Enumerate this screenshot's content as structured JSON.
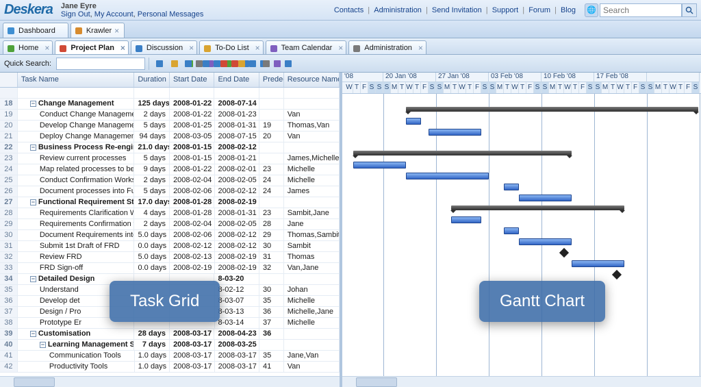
{
  "app": {
    "logo": "Deskera",
    "user": "Jane Eyre",
    "user_links": [
      "Sign Out",
      "My Account",
      "Personal Messages"
    ],
    "header_links": [
      "Contacts",
      "Administration",
      "Send Invitation",
      "Support",
      "Forum",
      "Blog"
    ],
    "search_placeholder": "Search"
  },
  "toptabs": [
    {
      "label": "Dashboard"
    },
    {
      "label": "Krawler",
      "active": true
    }
  ],
  "subtabs": [
    {
      "label": "Home"
    },
    {
      "label": "Project Plan",
      "active": true
    },
    {
      "label": "Discussion"
    },
    {
      "label": "To-Do List"
    },
    {
      "label": "Team Calendar"
    },
    {
      "label": "Administration"
    }
  ],
  "quick_search_label": "Quick Search:",
  "toolbar_icons": [
    "new",
    "open",
    "save",
    "cut",
    "copy",
    "print",
    "export",
    "import",
    "indent",
    "outdent",
    "undo",
    "redo",
    "up",
    "down",
    "add-user",
    "remove-user",
    "link",
    "zoom-in",
    "zoom-out",
    "filter",
    "columns",
    "settings",
    "help"
  ],
  "grid": {
    "cols": [
      "",
      "Task Name",
      "Duration",
      "Start Date",
      "End Date",
      "Predec",
      "Resource Names"
    ],
    "rows": [
      {
        "n": "",
        "task": "",
        "dur": "",
        "sd": "",
        "ed": "",
        "pred": "",
        "res": ""
      },
      {
        "n": "18",
        "task": "Change Management",
        "dur": "125 days",
        "sd": "2008-01-22",
        "ed": "2008-07-14",
        "pred": "",
        "res": "",
        "parent": true,
        "indent": 1
      },
      {
        "n": "19",
        "task": "Conduct Change Management Pl",
        "dur": "2 days",
        "sd": "2008-01-22",
        "ed": "2008-01-23",
        "pred": "",
        "res": "Van",
        "indent": 2
      },
      {
        "n": "20",
        "task": "Develop Change Management Pl",
        "dur": "5 days",
        "sd": "2008-01-25",
        "ed": "2008-01-31",
        "pred": "19",
        "res": "Thomas,Van",
        "indent": 2
      },
      {
        "n": "21",
        "task": "Deploy Change Management Act",
        "dur": "94 days",
        "sd": "2008-03-05",
        "ed": "2008-07-15",
        "pred": "20",
        "res": "Van",
        "indent": 2
      },
      {
        "n": "22",
        "task": "Business Process Re-engineerin",
        "dur": "21.0 days",
        "sd": "2008-01-15",
        "ed": "2008-02-12",
        "pred": "",
        "res": "",
        "parent": true,
        "indent": 1
      },
      {
        "n": "23",
        "task": "Review current processes",
        "dur": "5 days",
        "sd": "2008-01-15",
        "ed": "2008-01-21",
        "pred": "",
        "res": "James,Michelle",
        "indent": 2
      },
      {
        "n": "24",
        "task": "Map related processes to best p",
        "dur": "9 days",
        "sd": "2008-01-22",
        "ed": "2008-02-01",
        "pred": "23",
        "res": "Michelle",
        "indent": 2
      },
      {
        "n": "25",
        "task": "Conduct Confirmation Workshop",
        "dur": "2 days",
        "sd": "2008-02-04",
        "ed": "2008-02-05",
        "pred": "24",
        "res": "Michelle",
        "indent": 2
      },
      {
        "n": "26",
        "task": "Document processes into Functi",
        "dur": "5 days",
        "sd": "2008-02-06",
        "ed": "2008-02-12",
        "pred": "24",
        "res": "James",
        "indent": 2
      },
      {
        "n": "27",
        "task": "Functional Requirement Study",
        "dur": "17.0 days",
        "sd": "2008-01-28",
        "ed": "2008-02-19",
        "pred": "",
        "res": "",
        "parent": true,
        "indent": 1
      },
      {
        "n": "28",
        "task": "Requirements Clarification Works",
        "dur": "4 days",
        "sd": "2008-01-28",
        "ed": "2008-01-31",
        "pred": "23",
        "res": "Sambit,Jane",
        "indent": 2
      },
      {
        "n": "29",
        "task": "Requirements Confirmation work",
        "dur": "2 days",
        "sd": "2008-02-04",
        "ed": "2008-02-05",
        "pred": "28",
        "res": "Jane",
        "indent": 2
      },
      {
        "n": "30",
        "task": "Document Requirements into FRD",
        "dur": "5.0 days",
        "sd": "2008-02-06",
        "ed": "2008-02-12",
        "pred": "29",
        "res": "Thomas,Sambit",
        "indent": 2
      },
      {
        "n": "31",
        "task": "Submit 1st Draft of FRD",
        "dur": "0.0 days",
        "sd": "2008-02-12",
        "ed": "2008-02-12",
        "pred": "30",
        "res": "Sambit",
        "indent": 2
      },
      {
        "n": "32",
        "task": "Review FRD",
        "dur": "5.0 days",
        "sd": "2008-02-13",
        "ed": "2008-02-19",
        "pred": "31",
        "res": "Thomas",
        "indent": 2
      },
      {
        "n": "33",
        "task": "FRD Sign-off",
        "dur": "0.0 days",
        "sd": "2008-02-19",
        "ed": "2008-02-19",
        "pred": "32",
        "res": "Van,Jane",
        "indent": 2
      },
      {
        "n": "34",
        "task": "Detailed Design",
        "dur": "",
        "sd": "",
        "ed": "",
        "pred": "",
        "res": "",
        "parent": true,
        "indent": 1,
        "ed_override": "8-03-20"
      },
      {
        "n": "35",
        "task": "Understand",
        "dur": "",
        "sd": "",
        "ed": "8-02-12",
        "pred": "30",
        "res": "Johan",
        "indent": 2
      },
      {
        "n": "36",
        "task": "Develop det",
        "dur": "",
        "sd": "",
        "ed": "8-03-07",
        "pred": "35",
        "res": "Michelle",
        "indent": 2
      },
      {
        "n": "37",
        "task": "Design / Pro",
        "dur": "",
        "sd": "",
        "ed": "8-03-13",
        "pred": "36",
        "res": "Michelle,Jane",
        "indent": 2
      },
      {
        "n": "38",
        "task": "Prototype Er",
        "dur": "",
        "sd": "",
        "ed": "8-03-14",
        "pred": "37",
        "res": "Michelle",
        "indent": 2
      },
      {
        "n": "39",
        "task": "Customisation",
        "dur": "28 days",
        "sd": "2008-03-17",
        "ed": "2008-04-23",
        "pred": "36",
        "res": "",
        "parent": true,
        "indent": 1
      },
      {
        "n": "40",
        "task": "Learning Management Syste",
        "dur": "7 days",
        "sd": "2008-03-17",
        "ed": "2008-03-25",
        "pred": "",
        "res": "",
        "parent": true,
        "indent": 2
      },
      {
        "n": "41",
        "task": "Communication Tools",
        "dur": "1.0 days",
        "sd": "2008-03-17",
        "ed": "2008-03-17",
        "pred": "35",
        "res": "Jane,Van",
        "indent": 3
      },
      {
        "n": "42",
        "task": "Productivity Tools",
        "dur": "1.0 days",
        "sd": "2008-03-17",
        "ed": "2008-03-17",
        "pred": "41",
        "res": "Van",
        "indent": 3
      }
    ]
  },
  "timeline": {
    "start_label": "'08",
    "weeks": [
      "20 Jan '08",
      "27 Jan '08",
      "03 Feb '08",
      "10 Feb '08",
      "17 Feb '08"
    ],
    "day_letters": [
      "S",
      "M",
      "T",
      "W",
      "T",
      "F",
      "S"
    ]
  },
  "overlays": {
    "left": "Task Grid",
    "right": "Gantt Chart"
  }
}
